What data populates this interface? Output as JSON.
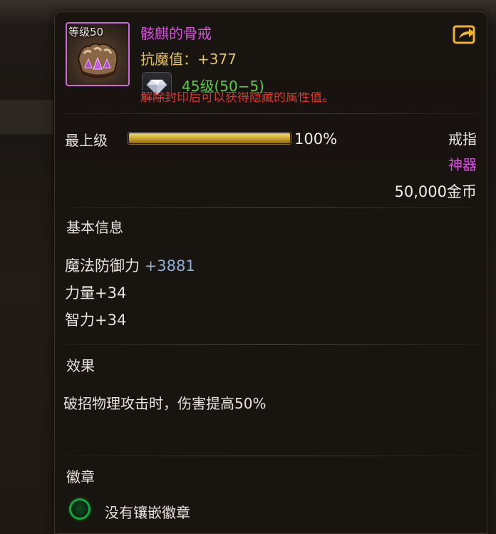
{
  "item": {
    "level_badge": "等级50",
    "name": "骸麒的骨戒",
    "stat_line": "抗魔值：+377",
    "gem_level": "45级(50−5)",
    "seal_hint": "解除封印后可以获得隐藏的属性值。",
    "icon": "bone-fist-ring-icon",
    "name_color": "#d94fe0"
  },
  "upgrade": {
    "label": "最上级",
    "percent_text": "100%",
    "progress": 1.0
  },
  "meta": {
    "type": "戒指",
    "rarity": "神器",
    "price": "50,000金币"
  },
  "basic_info": {
    "title": "基本信息",
    "magic_defense_label": "魔法防御力 ",
    "magic_defense_value": "+3881",
    "strength": "力量+34",
    "intelligence": "智力+34"
  },
  "effect": {
    "title": "效果",
    "text": "破招物理攻击时，伤害提高50%"
  },
  "emblem": {
    "title": "徽章",
    "empty_text": "没有镶嵌徽章"
  },
  "icons": {
    "share": "share-arrow-icon",
    "gem": "diamond-gem-icon",
    "emblem_slot": "emblem-slot-icon"
  }
}
